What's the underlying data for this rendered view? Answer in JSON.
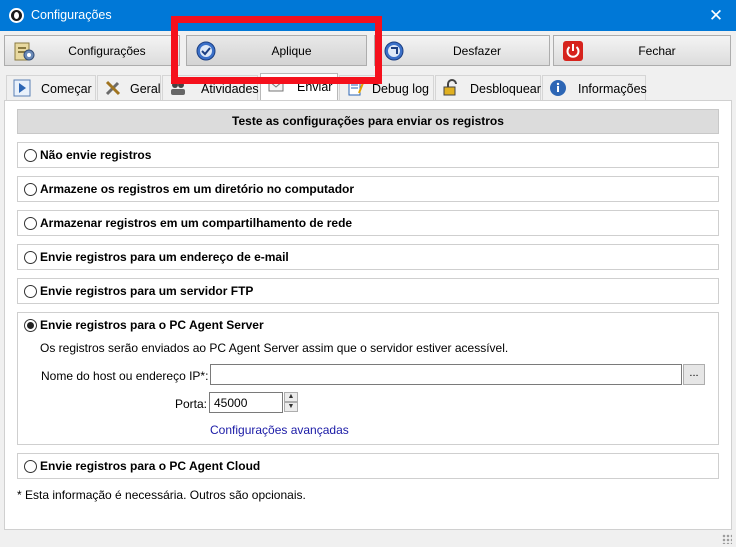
{
  "window": {
    "title": "Configurações"
  },
  "toolbar": {
    "configuracoes": "Configurações",
    "aplique": "Aplique",
    "desfazer": "Desfazer",
    "fechar": "Fechar"
  },
  "tabs": [
    {
      "label": "Começar",
      "icon": "play-icon"
    },
    {
      "label": "Geral",
      "icon": "tools-icon"
    },
    {
      "label": "Atividades",
      "icon": "people-icon"
    },
    {
      "label": "Enviar",
      "icon": "envelope-icon"
    },
    {
      "label": "Debug log",
      "icon": "notepad-icon"
    },
    {
      "label": "Desbloquear",
      "icon": "padlock-icon"
    },
    {
      "label": "Informações",
      "icon": "info-icon"
    }
  ],
  "panel": {
    "header": "Teste as configurações para enviar os registros",
    "options": [
      "Não envie registros",
      "Armazene os registros em um diretório no computador",
      "Armazenar registros em um compartilhamento de rede",
      "Envie registros para um endereço de e-mail",
      "Envie registros para um servidor FTP",
      "Envie registros para o PC Agent Server",
      "Envie registros para o PC Agent Cloud"
    ],
    "server": {
      "description": "Os registros serão enviados ao PC Agent Server assim que o servidor estiver acessível.",
      "host_label": "Nome do host ou endereço IP*:",
      "host_value": "",
      "browse_label": "...",
      "port_label": "Porta:",
      "port_value": "45000",
      "advanced_link": "Configurações avançadas"
    },
    "note": "* Esta informação é necessária. Outros são opcionais."
  },
  "colors": {
    "titlebar": "#0078d7",
    "highlight": "#f5101c",
    "link": "#1a1aa6"
  }
}
